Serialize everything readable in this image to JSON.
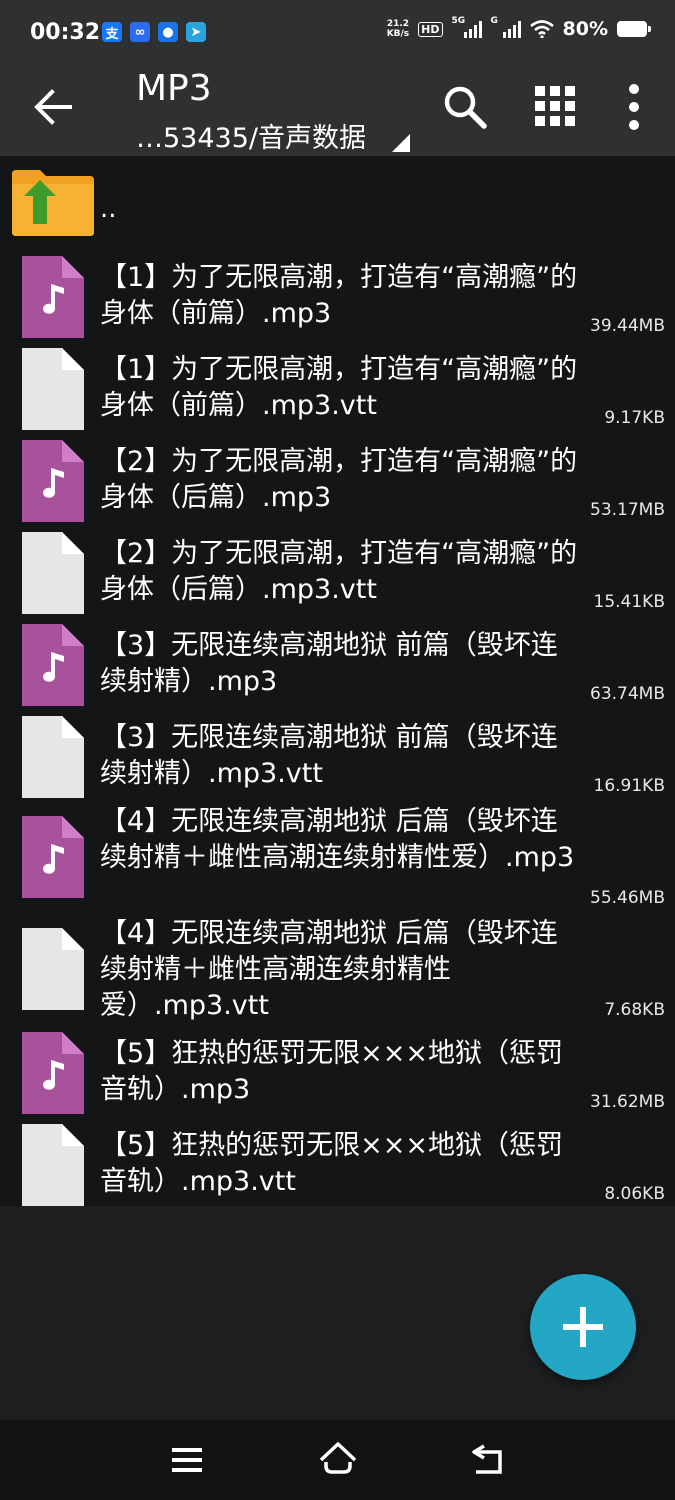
{
  "status_bar": {
    "time": "00:32",
    "net_speed_value": "21.2",
    "net_speed_unit": "KB/s",
    "hd_label": "HD",
    "sim1_tag": "5G",
    "sim2_tag": "G",
    "battery_percent": "80%",
    "app_icons": [
      {
        "name": "alipay-icon",
        "glyph": "支",
        "color": "#1677ff"
      },
      {
        "name": "chat-app-icon",
        "glyph": "∞",
        "color": "#2b6cf0"
      },
      {
        "name": "qq-icon",
        "glyph": "●",
        "color": "#1a74e8"
      },
      {
        "name": "telegram-icon",
        "glyph": "➤",
        "color": "#2aa3df"
      }
    ]
  },
  "app_bar": {
    "title": "MP3",
    "path": "…53435/音声数据"
  },
  "file_list": {
    "parent_label": "..",
    "files": [
      {
        "name": "【1】为了无限高潮，打造有“高潮瘾”的身体（前篇）.mp3",
        "size": "39.44MB",
        "type": "audio"
      },
      {
        "name": "【1】为了无限高潮，打造有“高潮瘾”的身体（前篇）.mp3.vtt",
        "size": "9.17KB",
        "type": "text"
      },
      {
        "name": "【2】为了无限高潮，打造有“高潮瘾”的身体（后篇）.mp3",
        "size": "53.17MB",
        "type": "audio"
      },
      {
        "name": "【2】为了无限高潮，打造有“高潮瘾”的身体（后篇）.mp3.vtt",
        "size": "15.41KB",
        "type": "text"
      },
      {
        "name": "【3】无限连续高潮地狱 前篇（毁坏连续射精）.mp3",
        "size": "63.74MB",
        "type": "audio"
      },
      {
        "name": "【3】无限连续高潮地狱 前篇（毁坏连续射精）.mp3.vtt",
        "size": "16.91KB",
        "type": "text"
      },
      {
        "name": "【4】无限连续高潮地狱 后篇（毁坏连续射精＋雌性高潮连续射精性爱）.mp3",
        "size": "55.46MB",
        "type": "audio"
      },
      {
        "name": "【4】无限连续高潮地狱 后篇（毁坏连续射精＋雌性高潮连续射精性爱）.mp3.vtt",
        "size": "7.68KB",
        "type": "text"
      },
      {
        "name": "【5】狂热的惩罚无限×××地狱（惩罚音轨）.mp3",
        "size": "31.62MB",
        "type": "audio"
      },
      {
        "name": "【5】狂热的惩罚无限×××地狱（惩罚音轨）.mp3.vtt",
        "size": "8.06KB",
        "type": "text"
      }
    ]
  },
  "colors": {
    "audio_icon": "#a8529c",
    "text_icon": "#e6e6e6",
    "fab": "#23a7c4",
    "folder": "#f2a01f",
    "folder_arrow": "#3f9c2a"
  }
}
